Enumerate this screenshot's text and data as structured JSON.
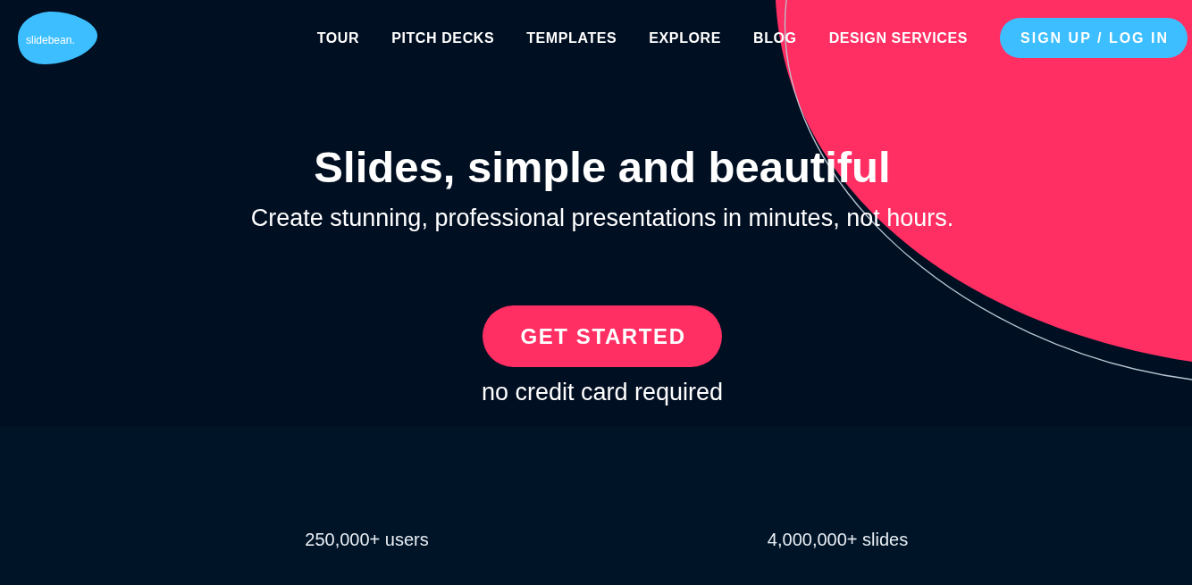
{
  "logo": {
    "text": "slidebean."
  },
  "nav": {
    "items": [
      {
        "label": "TOUR"
      },
      {
        "label": "PITCH DECKS"
      },
      {
        "label": "TEMPLATES"
      },
      {
        "label": "EXPLORE"
      },
      {
        "label": "BLOG"
      },
      {
        "label": "DESIGN SERVICES"
      }
    ],
    "cta": "SIGN UP / LOG IN"
  },
  "hero": {
    "title": "Slides, simple and beautiful",
    "subtitle": "Create stunning, professional presentations in minutes, not hours.",
    "button": "GET STARTED",
    "note": "no credit card required"
  },
  "stats": [
    {
      "text": "250,000+ users"
    },
    {
      "text": "4,000,000+ slides"
    }
  ]
}
